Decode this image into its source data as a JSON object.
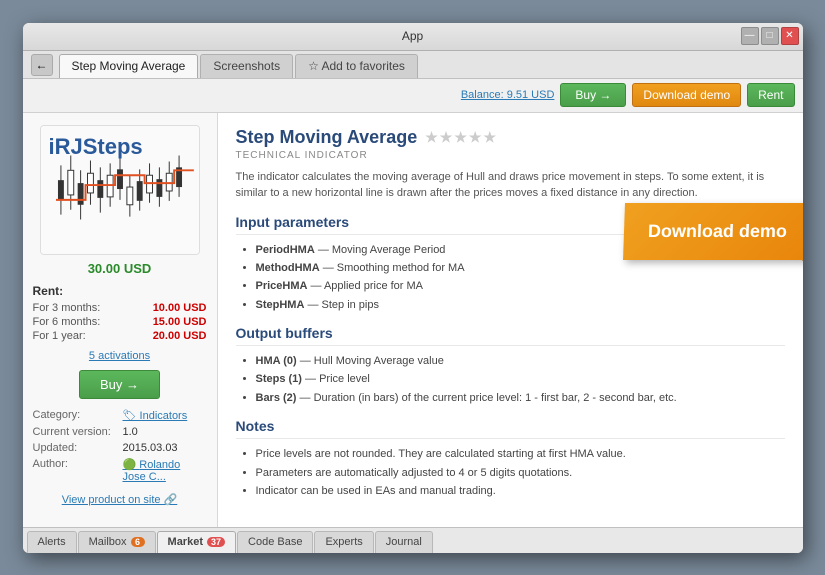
{
  "window": {
    "title": "App",
    "controls": {
      "minimize": "—",
      "maximize": "□",
      "close": "✕"
    }
  },
  "tab_bar": {
    "back_arrow": "←",
    "tabs": [
      {
        "id": "step-moving",
        "label": "Step Moving Average",
        "active": false
      },
      {
        "id": "screenshots",
        "label": "Screenshots",
        "active": false
      },
      {
        "id": "add-favorites",
        "label": "☆ Add to favorites",
        "active": false
      }
    ]
  },
  "toolbar": {
    "balance": "Balance: 9.51 USD",
    "buy_label": "Buy →",
    "download_demo_label": "Download demo",
    "rent_label": "Rent"
  },
  "left_panel": {
    "logo_text": "iRJSteps",
    "price": "30.00 USD",
    "rent_title": "Rent:",
    "rent_options": [
      {
        "period": "For 3 months:",
        "price": "10.00 USD"
      },
      {
        "period": "For 6 months:",
        "price": "15.00 USD"
      },
      {
        "period": "For 1 year:",
        "price": "20.00 USD"
      }
    ],
    "activations": "5 activations",
    "buy_btn": "Buy →",
    "meta": {
      "category_label": "Category:",
      "category_value": "Indicators",
      "version_label": "Current version:",
      "version_value": "1.0",
      "updated_label": "Updated:",
      "updated_value": "2015.03.03",
      "author_label": "Author:",
      "author_value": "Rolando Jose C..."
    },
    "view_product_link": "View product on site 🔗"
  },
  "right_panel": {
    "product_title": "Step Moving Average",
    "product_type": "TECHNICAL INDICATOR",
    "stars_count": 5,
    "description": "The indicator calculates the moving average of Hull and draws price movement in steps. To some extent, it is similar to a new horizontal line is drawn after the prices moves a fixed distance in any direction.",
    "sections": [
      {
        "title": "Input parameters",
        "items": [
          {
            "name": "PeriodHMA",
            "desc": "Moving Average Period"
          },
          {
            "name": "MethodHMA",
            "desc": "Smoothing method for MA"
          },
          {
            "name": "PriceHMA",
            "desc": "Applied price for MA"
          },
          {
            "name": "StepHMA",
            "desc": "Step in pips"
          }
        ]
      },
      {
        "title": "Output buffers",
        "items": [
          {
            "name": "HMA (0)",
            "desc": "Hull Moving Average value"
          },
          {
            "name": "Steps (1)",
            "desc": "Price level"
          },
          {
            "name": "Bars (2)",
            "desc": "Duration (in bars) of the current price level: 1 - first bar, 2 - second bar, etc."
          }
        ]
      },
      {
        "title": "Notes",
        "items": [
          {
            "name": "",
            "desc": "Price levels are not rounded. They are calculated starting at first HMA value."
          },
          {
            "name": "",
            "desc": "Parameters are automatically adjusted to 4 or 5 digits quotations."
          },
          {
            "name": "",
            "desc": "Indicator can be used in EAs and manual trading."
          }
        ]
      }
    ]
  },
  "download_demo_banner": "Download demo",
  "bottom_tabs": [
    {
      "id": "alerts",
      "label": "Alerts",
      "badge": null,
      "active": false
    },
    {
      "id": "mailbox",
      "label": "Mailbox",
      "badge": "6",
      "badge_color": "orange",
      "active": false
    },
    {
      "id": "market",
      "label": "Market",
      "badge": "37",
      "badge_color": "red",
      "active": true
    },
    {
      "id": "codebase",
      "label": "Code Base",
      "badge": null,
      "active": false
    },
    {
      "id": "experts",
      "label": "Experts",
      "badge": null,
      "active": false
    },
    {
      "id": "journal",
      "label": "Journal",
      "badge": null,
      "active": false
    }
  ]
}
